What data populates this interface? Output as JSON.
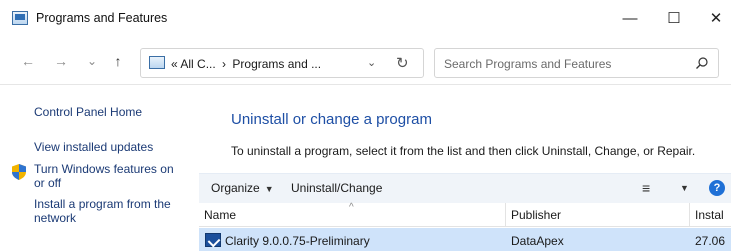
{
  "window": {
    "title": "Programs and Features",
    "controls": {
      "minimize": "—",
      "maximize": "☐",
      "close": "✕"
    }
  },
  "nav": {
    "back": "←",
    "forward": "→",
    "recent": "⌄",
    "up": "↑",
    "address": {
      "prefix": "«",
      "crumb1": "All C...",
      "separator": "›",
      "crumb2": "Programs and ...",
      "dropdown": "⌄",
      "refresh": "↻"
    },
    "search_placeholder": "Search Programs and Features"
  },
  "sidebar": {
    "items": [
      {
        "label": "Control Panel Home"
      },
      {
        "label": "View installed updates"
      },
      {
        "label": "Turn Windows features on or off",
        "icon": "shield-icon"
      },
      {
        "label": "Install a program from the network"
      }
    ]
  },
  "main": {
    "title": "Uninstall or change a program",
    "description": "To uninstall a program, select it from the list and then click Uninstall, Change, or Repair."
  },
  "toolbar": {
    "organize": "Organize",
    "organize_caret": "▼",
    "uninstall_change": "Uninstall/Change",
    "view_icon": "≡",
    "view_caret": "▼",
    "help": "?"
  },
  "table": {
    "columns": [
      "Name",
      "Publisher",
      "Instal"
    ],
    "sort_indicator": "^",
    "rows": [
      {
        "name": "Clarity 9.0.0.75-Preliminary",
        "publisher": "DataApex",
        "installed": "27.06"
      }
    ]
  },
  "colors": {
    "title_blue": "#1e4fa5",
    "link_blue": "#1b3a75",
    "toolbar_bg": "#f0f4f9",
    "selected_row": "#cfe3fa",
    "help_blue": "#1f70d6"
  }
}
